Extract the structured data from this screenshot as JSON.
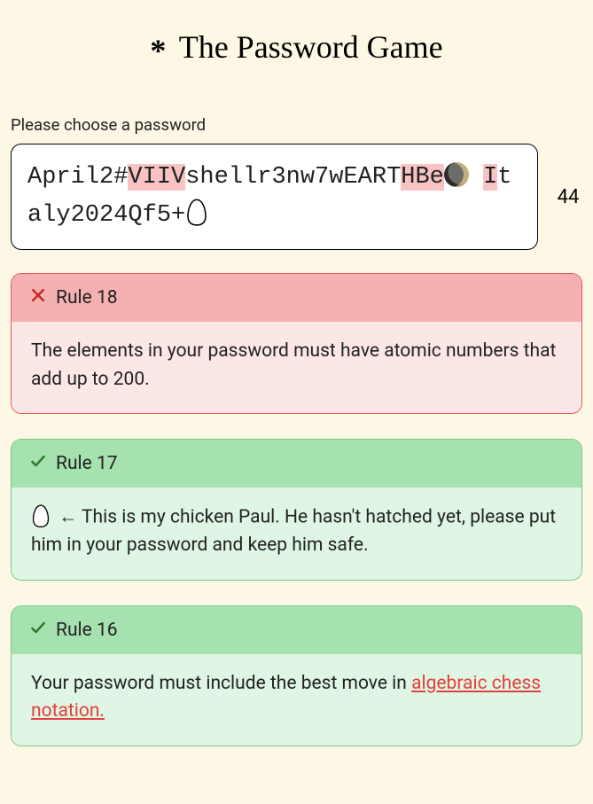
{
  "title_prefix": "*",
  "title_text": "The Password Game",
  "prompt": "Please choose a password",
  "char_count": "44",
  "password_segments": [
    {
      "text": "April2#",
      "hl": false
    },
    {
      "text": "VIIV",
      "hl": true
    },
    {
      "text": "shellr3nw7wEART",
      "hl": false
    },
    {
      "text": "HBe",
      "hl": true
    },
    {
      "text": " ",
      "hl": false,
      "icon": "moon"
    },
    {
      "text": "I",
      "hl": true
    },
    {
      "text": "taly2024Qf5+",
      "hl": false
    },
    {
      "text": "",
      "hl": false,
      "icon": "egg"
    }
  ],
  "rules": [
    {
      "status": "fail",
      "label": "Rule 18",
      "body": "The elements in your password must have atomic numbers that add up to 200."
    },
    {
      "status": "pass",
      "label": "Rule 17",
      "body_prefix_icon": "egg",
      "body": " ← This is my chicken Paul. He hasn't hatched yet, please put him in your password and keep him safe."
    },
    {
      "status": "pass",
      "label": "Rule 16",
      "body": "Your password must include the best move in ",
      "link_text": "algebraic chess notation.",
      "link_href": "#"
    }
  ]
}
